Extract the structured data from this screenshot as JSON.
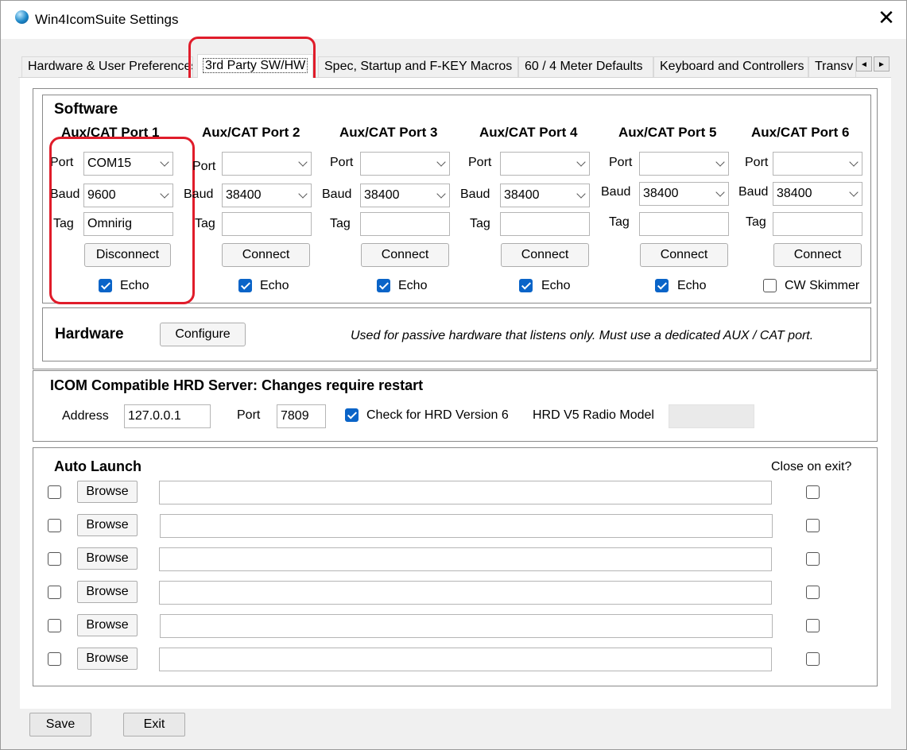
{
  "window": {
    "title": "Win4IcomSuite Settings",
    "close_glyph": "✕"
  },
  "tabs": [
    {
      "label": "Hardware & User Preferences"
    },
    {
      "label": "3rd Party SW/HW"
    },
    {
      "label": "Spec, Startup and F-KEY Macros"
    },
    {
      "label": "60 / 4 Meter Defaults"
    },
    {
      "label": "Keyboard and Controllers"
    },
    {
      "label": "Transv"
    }
  ],
  "tab_scroll": {
    "left": "◄",
    "right": "►"
  },
  "software": {
    "title": "Software",
    "labels": {
      "port": "Port",
      "baud": "Baud",
      "tag": "Tag"
    },
    "ports": [
      {
        "header": "Aux/CAT Port 1",
        "port": "COM15",
        "baud": "9600",
        "tag": "Omnirig",
        "button": "Disconnect",
        "check_label": "Echo",
        "checked": true
      },
      {
        "header": "Aux/CAT Port 2",
        "port": "",
        "baud": "38400",
        "tag": "",
        "button": "Connect",
        "check_label": "Echo",
        "checked": true
      },
      {
        "header": "Aux/CAT Port 3",
        "port": "",
        "baud": "38400",
        "tag": "",
        "button": "Connect",
        "check_label": "Echo",
        "checked": true
      },
      {
        "header": "Aux/CAT Port 4",
        "port": "",
        "baud": "38400",
        "tag": "",
        "button": "Connect",
        "check_label": "Echo",
        "checked": true
      },
      {
        "header": "Aux/CAT Port 5",
        "port": "",
        "baud": "38400",
        "tag": "",
        "button": "Connect",
        "check_label": "Echo",
        "checked": true
      },
      {
        "header": "Aux/CAT Port 6",
        "port": "",
        "baud": "38400",
        "tag": "",
        "button": "Connect",
        "check_label": "CW Skimmer",
        "checked": false
      }
    ]
  },
  "hardware": {
    "title": "Hardware",
    "configure_label": "Configure",
    "note": "Used for passive hardware that listens only. Must use a dedicated AUX / CAT port."
  },
  "hrd": {
    "title": "ICOM Compatible HRD Server: Changes require restart",
    "address_label": "Address",
    "address_value": "127.0.0.1",
    "port_label": "Port",
    "port_value": "7809",
    "check_label": "Check for HRD Version 6",
    "check_checked": true,
    "model_label": "HRD V5 Radio Model",
    "model_value": ""
  },
  "auto_launch": {
    "title": "Auto Launch",
    "close_header": "Close on exit?",
    "rows": [
      {
        "enabled": false,
        "browse": "Browse",
        "path": "",
        "close_on_exit": false
      },
      {
        "enabled": false,
        "browse": "Browse",
        "path": "",
        "close_on_exit": false
      },
      {
        "enabled": false,
        "browse": "Browse",
        "path": "",
        "close_on_exit": false
      },
      {
        "enabled": false,
        "browse": "Browse",
        "path": "",
        "close_on_exit": false
      },
      {
        "enabled": false,
        "browse": "Browse",
        "path": "",
        "close_on_exit": false
      },
      {
        "enabled": false,
        "browse": "Browse",
        "path": "",
        "close_on_exit": false
      }
    ]
  },
  "footer": {
    "save_label": "Save",
    "exit_label": "Exit"
  },
  "colors": {
    "highlight": "#e01c2a",
    "checkbox_accent": "#0a64c8"
  }
}
